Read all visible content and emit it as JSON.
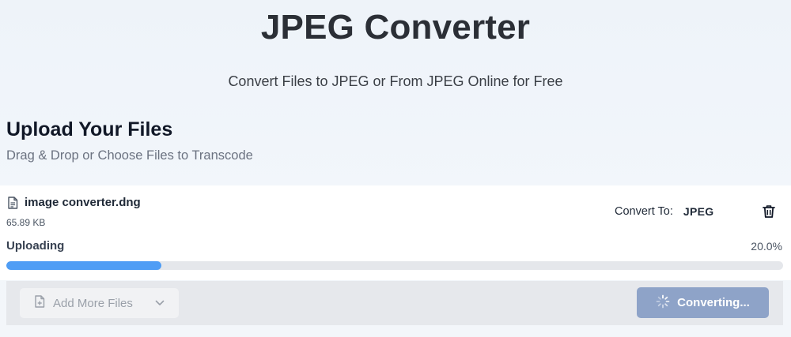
{
  "hero": {
    "title": "JPEG Converter",
    "subtitle": "Convert Files to JPEG or From JPEG Online for Free"
  },
  "upload": {
    "title": "Upload Your Files",
    "subtitle": "Drag & Drop or Choose Files to Transcode"
  },
  "file": {
    "name": "image converter.dng",
    "size": "65.89 KB",
    "icon": "document-icon",
    "convert_to_label": "Convert To:",
    "convert_format": "JPEG",
    "delete_icon": "trash-icon",
    "status_label": "Uploading",
    "progress_text": "20.0%",
    "progress_fraction": 0.2
  },
  "actions": {
    "add_files_label": "Add More Files",
    "add_files_icon": "file-plus-icon",
    "dropdown_icon": "chevron-down-icon",
    "converting_label": "Converting...",
    "converting_icon": "spinner-icon"
  },
  "colors": {
    "progress_fill": "#4f9df5",
    "progress_track": "#e5e7eb",
    "converting_button": "#8ea3c8"
  }
}
